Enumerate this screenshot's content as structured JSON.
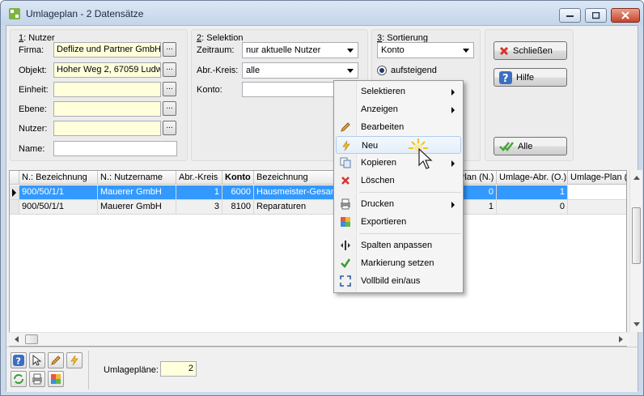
{
  "window": {
    "title": "Umlageplan - 2 Datensätze"
  },
  "nutzer_group": {
    "label_num": "1",
    "label_rest": ": Nutzer",
    "firma_label": "Firma:",
    "firma_value": "Deflize und Partner GmbH",
    "objekt_label": "Objekt:",
    "objekt_value": "Hoher Weg 2, 67059 Ludw",
    "einheit_label": "Einheit:",
    "ebene_label": "Ebene:",
    "nutzer_label": "Nutzer:",
    "name_label": "Name:",
    "dots": "..."
  },
  "selektion_group": {
    "label_num": "2",
    "label_rest": ": Selektion",
    "zeitraum_label": "Zeitraum:",
    "zeitraum_value": "nur aktuelle Nutzer",
    "abrkreis_label": "Abr.-Kreis:",
    "abrkreis_value": "alle",
    "konto_label": "Konto:"
  },
  "sortierung_group": {
    "label_num": "3",
    "label_rest": ": Sortierung",
    "sort_value": "Konto",
    "asc_label": "aufsteigend"
  },
  "buttons": {
    "close_label": "Schließen",
    "help_label": "Hilfe",
    "all_label": "Alle"
  },
  "table": {
    "headers": [
      "N.: Bezeichnung",
      "N.: Nutzername",
      "Abr.-Kreis",
      "Konto",
      "Bezeichnung",
      "Plan (N.)",
      "Umlage-Abr. (O.)",
      "Umlage-Plan ("
    ],
    "rows": [
      [
        "900/50/1/1",
        "Mauerer GmbH",
        "1",
        "6000",
        "Hausmeister-Gesam",
        "0",
        "1",
        ""
      ],
      [
        "900/50/1/1",
        "Mauerer GmbH",
        "3",
        "8100",
        "Reparaturen",
        "1",
        "0",
        ""
      ]
    ]
  },
  "context_menu": {
    "items": [
      {
        "label": "Selektieren",
        "icon": "none",
        "submenu": true
      },
      {
        "label": "Anzeigen",
        "icon": "none",
        "submenu": true
      },
      {
        "label": "Bearbeiten",
        "icon": "pencil-icon",
        "submenu": false
      },
      {
        "label": "Neu",
        "icon": "lightning-icon",
        "submenu": false
      },
      {
        "label": "Kopieren",
        "icon": "copy-icon",
        "submenu": true
      },
      {
        "label": "Löschen",
        "icon": "delete-x-icon",
        "submenu": false
      },
      {
        "label": "Drucken",
        "icon": "printer-icon",
        "submenu": true
      },
      {
        "label": "Exportieren",
        "icon": "export-icon",
        "submenu": false
      },
      {
        "label": "Spalten anpassen",
        "icon": "columns-icon",
        "submenu": false
      },
      {
        "label": "Markierung setzen",
        "icon": "checkmark-icon",
        "submenu": false
      },
      {
        "label": "Vollbild ein/aus",
        "icon": "fullscreen-icon",
        "submenu": false
      }
    ]
  },
  "footer": {
    "count_label": "Umlagepläne:",
    "count_value": "2"
  },
  "colors": {
    "selection": "#3399ff",
    "yellow_field": "#ffffdc",
    "titlebar": "#c3d5ea"
  }
}
